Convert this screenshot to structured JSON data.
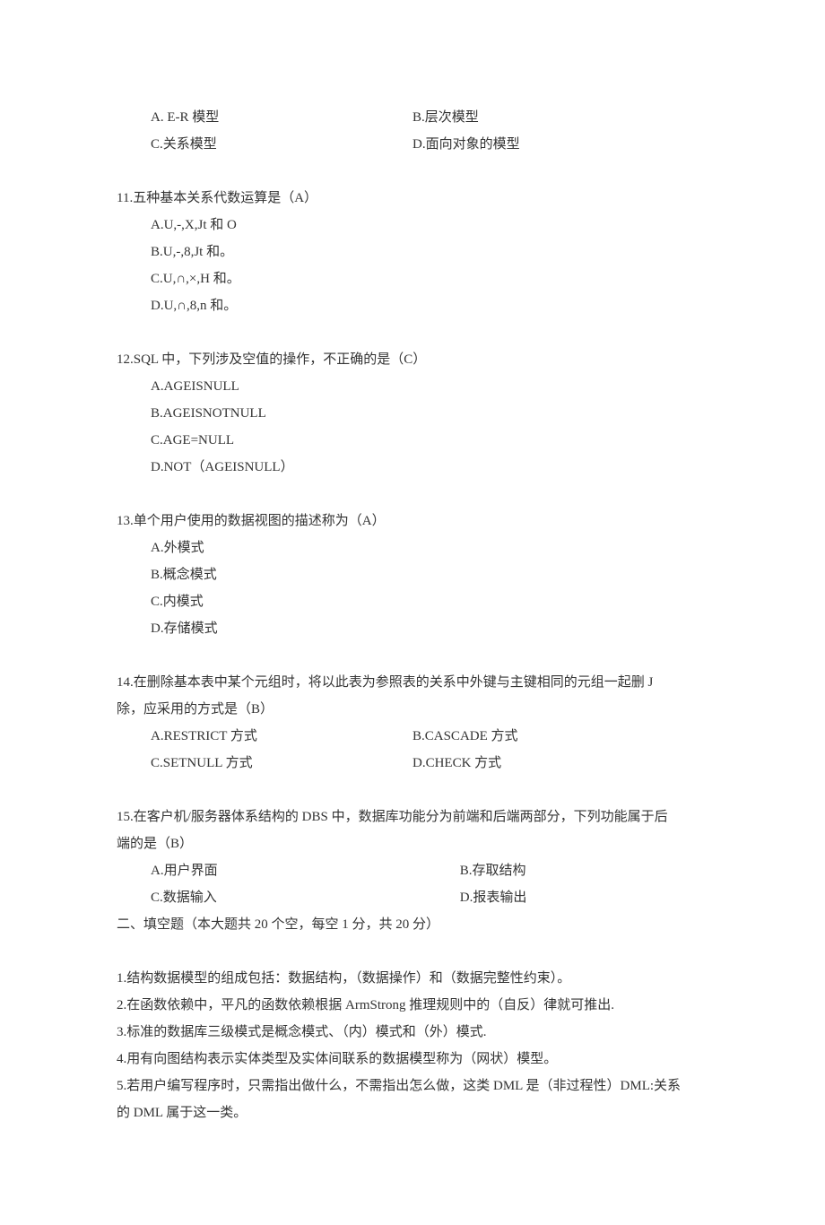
{
  "q10_options": {
    "a": "A. E-R 模型",
    "b": "B.层次模型",
    "c": "C.关系模型",
    "d": "D.面向对象的模型"
  },
  "q11": {
    "stem": "11.五种基本关系代数运算是（A）",
    "a": "A.U,-,X,Jt 和 O",
    "b": "B.U,-,8,Jt 和。",
    "c": "C.U,∩,×,H 和。",
    "d": "D.U,∩,8,n 和。"
  },
  "q12": {
    "stem": "12.SQL 中，下列涉及空值的操作，不正确的是（C）",
    "a": "A.AGEISNULL",
    "b": "B.AGEISNOTNULL",
    "c": "C.AGE=NULL",
    "d": "D.NOT（AGEISNULL）"
  },
  "q13": {
    "stem": "13.单个用户使用的数据视图的描述称为（A）",
    "a": "A.外模式",
    "b": "B.概念模式",
    "c": "C.内模式",
    "d": "D.存储模式"
  },
  "q14": {
    "stem1": "14.在删除基本表中某个元组时，将以此表为参照表的关系中外键与主键相同的元组一起删 J",
    "stem2": "除，应采用的方式是（B）",
    "a": "A.RESTRICT 方式",
    "b": "B.CASCADE 方式",
    "c": "C.SETNULL 方式",
    "d": "D.CHECK 方式"
  },
  "q15": {
    "stem1": "15.在客户机/服务器体系结构的 DBS 中，数据库功能分为前端和后端两部分，下列功能属于后",
    "stem2": "端的是（B）",
    "a": "A.用户界面",
    "b": "B.存取结构",
    "c": "C.数据输入",
    "d": "D.报表输出"
  },
  "section2_heading": "二、填空题（本大题共 20 个空，每空 1 分，共 20 分）",
  "fill": {
    "f1": "1.结构数据模型的组成包括：数据结构，（数据操作）和（数据完整性约束）。",
    "f2": "2.在函数依赖中，平凡的函数依赖根据 ArmStrong 推理规则中的（自反）律就可推出.",
    "f3": "3.标准的数据库三级模式是概念模式、（内）模式和（外）模式.",
    "f4": "4.用有向图结构表示实体类型及实体间联系的数据模型称为（网状）模型。",
    "f5a": "5.若用户编写程序时，只需指出做什么，不需指出怎么做，这类 DML 是（非过程性）DML:关系",
    "f5b": "的 DML 属于这一类。"
  }
}
